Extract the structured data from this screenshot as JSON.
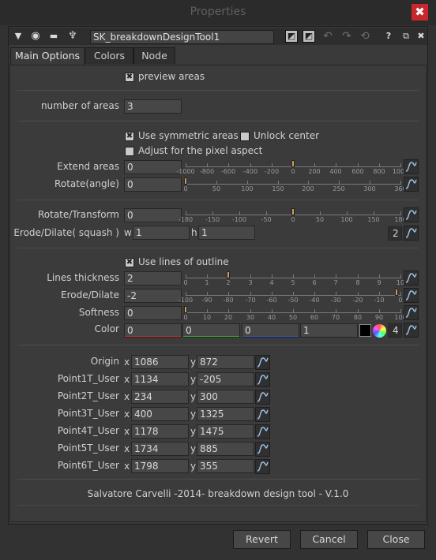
{
  "window": {
    "title": "Properties",
    "close_glyph": "✖"
  },
  "toolbar": {
    "node_name": "SK_breakdownDesignTool1",
    "help": "?",
    "buttons": [
      "collapse-icon",
      "circle-icon",
      "pin-icon",
      "wrench-icon",
      "node-color-icon",
      "gradient-icon",
      "undo-icon",
      "redo-icon",
      "revert-icon",
      "help-icon",
      "float-icon",
      "close-icon"
    ]
  },
  "tabs": [
    "Main Options",
    "Colors",
    "Node"
  ],
  "main": {
    "preview_areas": {
      "label": "preview areas",
      "checked": true
    },
    "number_of_areas": {
      "label": "number of areas",
      "value": "3"
    },
    "use_symmetric": {
      "label": "Use symmetric areas",
      "checked": true
    },
    "unlock_center": {
      "label": "Unlock center",
      "checked": false
    },
    "adjust_pixel": {
      "label": "Adjust for the pixel aspect",
      "checked": false
    },
    "extend_areas": {
      "label": "Extend areas",
      "value": "0",
      "ticks": [
        "-1000",
        "-800",
        "-600",
        "-400",
        "-200",
        "0",
        "200",
        "400",
        "600",
        "800",
        "1000"
      ]
    },
    "rotate_angle": {
      "label": "Rotate(angle)",
      "value": "0",
      "ticks": [
        "0",
        "50",
        "100",
        "150",
        "200",
        "250",
        "300",
        "360"
      ]
    },
    "rotate_transform": {
      "label": "Rotate/Transform",
      "value": "0",
      "ticks": [
        "-180",
        "-150",
        "-100",
        "-50",
        "0",
        "50",
        "100",
        "150",
        "180"
      ]
    },
    "erode_squash": {
      "label": "Erode/Dilate( squash )",
      "w_label": "w",
      "w": "1",
      "h_label": "h",
      "h": "1",
      "views": "2"
    },
    "use_outline": {
      "label": "Use lines of outline",
      "checked": true
    },
    "lines_thickness": {
      "label": "Lines thickness",
      "value": "2",
      "ticks": [
        "0",
        "1",
        "2",
        "3",
        "4",
        "5",
        "6",
        "7",
        "8",
        "9",
        "10"
      ]
    },
    "erode_dilate": {
      "label": "Erode/Dilate",
      "value": "-2",
      "ticks": [
        "-100",
        "-90",
        "-80",
        "-70",
        "-60",
        "-50",
        "-40",
        "-30",
        "-20",
        "-10",
        "0"
      ]
    },
    "softness": {
      "label": "Softness",
      "value": "0",
      "ticks": [
        "0",
        "10",
        "20",
        "30",
        "40",
        "50",
        "60",
        "70",
        "80",
        "90",
        "100"
      ]
    },
    "color": {
      "label": "Color",
      "r": "0",
      "g": "0",
      "b": "0",
      "a": "1",
      "channels": "4"
    },
    "points": [
      {
        "label": "Origin",
        "x": "1086",
        "y": "872"
      },
      {
        "label": "Point1T_User",
        "x": "1134",
        "y": "-205"
      },
      {
        "label": "Point2T_User",
        "x": "234",
        "y": "300"
      },
      {
        "label": "Point3T_User",
        "x": "400",
        "y": "1325"
      },
      {
        "label": "Point4T_User",
        "x": "1178",
        "y": "1475"
      },
      {
        "label": "Point5T_User",
        "x": "1734",
        "y": "885"
      },
      {
        "label": "Point6T_User",
        "x": "1798",
        "y": "355"
      }
    ],
    "xy_labels": {
      "x": "x",
      "y": "y"
    },
    "credit": "Salvatore Carvelli -2014- breakdown design tool - V.1.0"
  },
  "footer": {
    "revert": "Revert",
    "cancel": "Cancel",
    "close": "Close"
  },
  "colors": {
    "slider_knob": "#c8a15a",
    "close_red": "#c8282b",
    "red_line": "#b33",
    "green_line": "#3a3",
    "blue_line": "#35b"
  }
}
